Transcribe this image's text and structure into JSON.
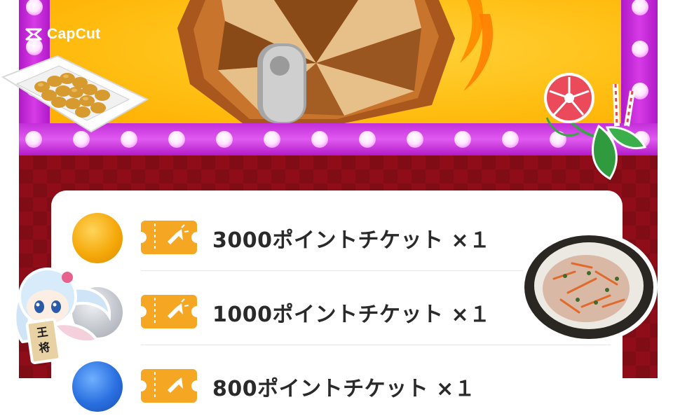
{
  "brand": {
    "name": "CapCut",
    "icon": "capcut-logo-icon"
  },
  "colors": {
    "stage_yellow": "#ffbf14",
    "frame_magenta": "#c22fd8",
    "panel_red": "#8e0d18",
    "ticket_orange": "#f5a623",
    "coin_gold": "#f0a400",
    "coin_silver": "#b8bcc2",
    "coin_blue": "#2a6fe0"
  },
  "prizes": [
    {
      "label": "3000ポイントチケット ×１",
      "coin": "gold-coin-icon",
      "ticket": "ticket-icon"
    },
    {
      "label": "1000ポイントチケット ×１",
      "coin": "silver-coin-icon",
      "ticket": "ticket-icon"
    },
    {
      "label": "800ポイントチケット ×１",
      "coin": "blue-coin-icon",
      "ticket": "ticket-icon"
    }
  ],
  "stickers": {
    "shogi_piece_text": "王将"
  }
}
